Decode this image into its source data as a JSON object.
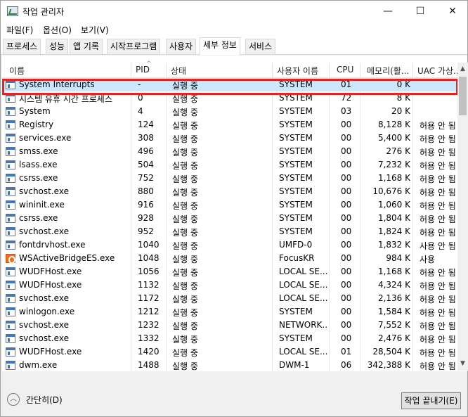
{
  "window": {
    "title": "작업 관리자",
    "minimize_glyph": "—",
    "maximize_glyph": "☐",
    "close_glyph": "✕"
  },
  "menu": {
    "items": [
      "파일(F)",
      "옵션(O)",
      "보기(V)"
    ]
  },
  "tabs": [
    "프로세스",
    "성능",
    "앱 기록",
    "시작프로그램",
    "사용자",
    "세부 정보",
    "서비스"
  ],
  "active_tab": "세부 정보",
  "columns": {
    "name": "이름",
    "pid": "PID",
    "status": "상태",
    "user": "사용자 이름",
    "cpu": "CPU",
    "memory": "메모리(활...",
    "uac": "UAC 가상..."
  },
  "processes": [
    {
      "name": "System Interrupts",
      "pid": "-",
      "status": "실행 중",
      "user": "SYSTEM",
      "cpu": "01",
      "memory": "0 K",
      "uac": "",
      "icon": "app-window-icon"
    },
    {
      "name": "시스템 유휴 시간 프로세스",
      "pid": "0",
      "status": "실행 중",
      "user": "SYSTEM",
      "cpu": "72",
      "memory": "8 K",
      "uac": "",
      "icon": "app-window-icon"
    },
    {
      "name": "System",
      "pid": "4",
      "status": "실행 중",
      "user": "SYSTEM",
      "cpu": "03",
      "memory": "20 K",
      "uac": "",
      "icon": "app-window-icon"
    },
    {
      "name": "Registry",
      "pid": "124",
      "status": "실행 중",
      "user": "SYSTEM",
      "cpu": "00",
      "memory": "8,128 K",
      "uac": "허용 안 됨",
      "icon": "app-window-icon"
    },
    {
      "name": "services.exe",
      "pid": "308",
      "status": "실행 중",
      "user": "SYSTEM",
      "cpu": "00",
      "memory": "5,400 K",
      "uac": "허용 안 됨",
      "icon": "app-window-icon"
    },
    {
      "name": "smss.exe",
      "pid": "496",
      "status": "실행 중",
      "user": "SYSTEM",
      "cpu": "00",
      "memory": "276 K",
      "uac": "허용 안 됨",
      "icon": "app-window-icon"
    },
    {
      "name": "lsass.exe",
      "pid": "504",
      "status": "실행 중",
      "user": "SYSTEM",
      "cpu": "00",
      "memory": "7,232 K",
      "uac": "허용 안 됨",
      "icon": "app-window-icon"
    },
    {
      "name": "csrss.exe",
      "pid": "752",
      "status": "실행 중",
      "user": "SYSTEM",
      "cpu": "00",
      "memory": "1,168 K",
      "uac": "허용 안 됨",
      "icon": "app-window-icon"
    },
    {
      "name": "svchost.exe",
      "pid": "880",
      "status": "실행 중",
      "user": "SYSTEM",
      "cpu": "00",
      "memory": "10,676 K",
      "uac": "허용 안 됨",
      "icon": "app-window-icon"
    },
    {
      "name": "wininit.exe",
      "pid": "916",
      "status": "실행 중",
      "user": "SYSTEM",
      "cpu": "00",
      "memory": "1,060 K",
      "uac": "허용 안 됨",
      "icon": "app-window-icon"
    },
    {
      "name": "csrss.exe",
      "pid": "928",
      "status": "실행 중",
      "user": "SYSTEM",
      "cpu": "00",
      "memory": "1,804 K",
      "uac": "허용 안 됨",
      "icon": "app-window-icon"
    },
    {
      "name": "svchost.exe",
      "pid": "952",
      "status": "실행 중",
      "user": "SYSTEM",
      "cpu": "00",
      "memory": "1,824 K",
      "uac": "허용 안 됨",
      "icon": "app-window-icon"
    },
    {
      "name": "fontdrvhost.exe",
      "pid": "1040",
      "status": "실행 중",
      "user": "UMFD-0",
      "cpu": "00",
      "memory": "1,832 K",
      "uac": "사용 안 됨",
      "icon": "app-window-icon"
    },
    {
      "name": "WSActiveBridgeES.exe",
      "pid": "1048",
      "status": "실행 중",
      "user": "FocusKR",
      "cpu": "00",
      "memory": "984 K",
      "uac": "사용",
      "icon": "orange-app-icon"
    },
    {
      "name": "WUDFHost.exe",
      "pid": "1056",
      "status": "실행 중",
      "user": "LOCAL SE...",
      "cpu": "00",
      "memory": "1,168 K",
      "uac": "허용 안 됨",
      "icon": "app-window-icon"
    },
    {
      "name": "WUDFHost.exe",
      "pid": "1132",
      "status": "실행 중",
      "user": "LOCAL SE...",
      "cpu": "00",
      "memory": "4,324 K",
      "uac": "허용 안 됨",
      "icon": "app-window-icon"
    },
    {
      "name": "svchost.exe",
      "pid": "1172",
      "status": "실행 중",
      "user": "LOCAL SE...",
      "cpu": "00",
      "memory": "2,136 K",
      "uac": "허용 안 됨",
      "icon": "app-window-icon"
    },
    {
      "name": "winlogon.exe",
      "pid": "1212",
      "status": "실행 중",
      "user": "SYSTEM",
      "cpu": "00",
      "memory": "1,584 K",
      "uac": "허용 안 됨",
      "icon": "app-window-icon"
    },
    {
      "name": "svchost.exe",
      "pid": "1232",
      "status": "실행 중",
      "user": "NETWORK...",
      "cpu": "00",
      "memory": "7,552 K",
      "uac": "허용 안 됨",
      "icon": "app-window-icon"
    },
    {
      "name": "svchost.exe",
      "pid": "1332",
      "status": "실행 중",
      "user": "SYSTEM",
      "cpu": "00",
      "memory": "2,476 K",
      "uac": "허용 안 됨",
      "icon": "app-window-icon"
    },
    {
      "name": "WUDFHost.exe",
      "pid": "1420",
      "status": "실행 중",
      "user": "LOCAL SE...",
      "cpu": "01",
      "memory": "28,504 K",
      "uac": "허용 안 됨",
      "icon": "app-window-icon"
    },
    {
      "name": "dwm.exe",
      "pid": "1488",
      "status": "실행 중",
      "user": "DWM-1",
      "cpu": "06",
      "memory": "342,388 K",
      "uac": "허용 안 됨",
      "icon": "app-window-icon"
    }
  ],
  "footer": {
    "fewer_details": "간단히(D)",
    "end_task": "작업 끝내기(E)"
  },
  "colors": {
    "selection": "#cce8ff",
    "highlight_border": "#e22424"
  }
}
